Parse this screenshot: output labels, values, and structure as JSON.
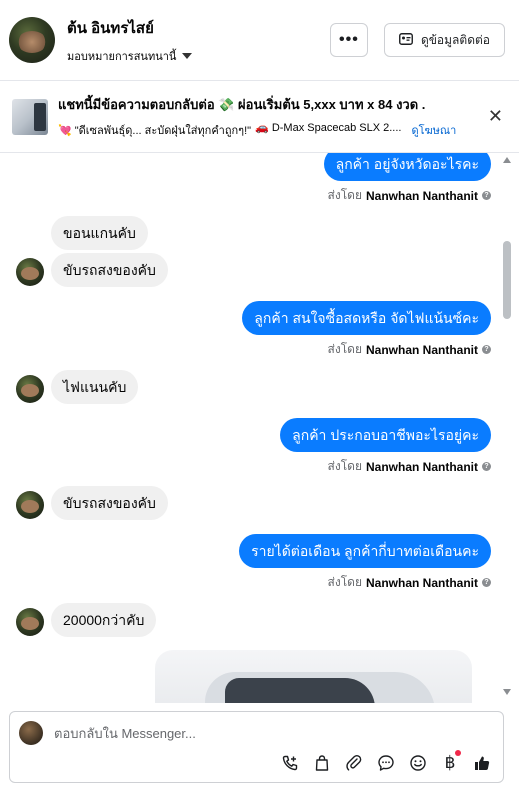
{
  "header": {
    "name": "ต้น อินทรไสย์",
    "subtitle": "มอบหมายการสนทนานี้",
    "more_label": "•••",
    "contact_label": "ดูข้อมูลติดต่อ"
  },
  "ad": {
    "title": "แชทนี้มีข้อความตอบกลับต่อ 💸 ผ่อนเริ่มต้น 5,xxx บาท x 84 งวด .",
    "line_left": "💘 \"ดีเซลพันธุ์ดุ... สะบัดฝุ่นใส่ทุกคำถูกๆ!\"",
    "line_right": "🚗 D-Max Spacecab SLX 2....",
    "link": "ดูโฆษณา"
  },
  "messages": {
    "m1": "ลูกค้า  อยู่จังหวัดอะไรคะ",
    "sent1_prefix": "ส่งโดย",
    "sent1_name": "Nanwhan Nanthanit",
    "m2": "ขอนแกนคับ",
    "m3": "ขับรถสงของคับ",
    "m4": "ลูกค้า สนใจซื้อสดหรือ จัดไฟแน้นซ์คะ",
    "sent2_prefix": "ส่งโดย",
    "sent2_name": "Nanwhan Nanthanit",
    "m5": "ไฟแนนคับ",
    "m6": "ลูกค้า ประกอบอาชีพอะไรอยู่คะ",
    "sent3_prefix": "ส่งโดย",
    "sent3_name": "Nanwhan Nanthanit",
    "m7": "ขับรถสงของคับ",
    "m8": "รายได้ต่อเดือน ลูกค้ากี่บาทต่อเดือนคะ",
    "sent4_prefix": "ส่งโดย",
    "sent4_name": "Nanwhan Nanthanit",
    "m9": "20000กว่าคับ"
  },
  "composer": {
    "placeholder": "ตอบกลับใน Messenger..."
  },
  "tools": [
    "add-call-icon",
    "bag-icon",
    "paperclip-icon",
    "chat-bubble-icon",
    "smiley-icon",
    "baht-icon",
    "thumbs-up-icon"
  ],
  "colors": {
    "outgoing": "#0a7cff",
    "incoming": "#f0f0f0",
    "link": "#0064d1"
  }
}
